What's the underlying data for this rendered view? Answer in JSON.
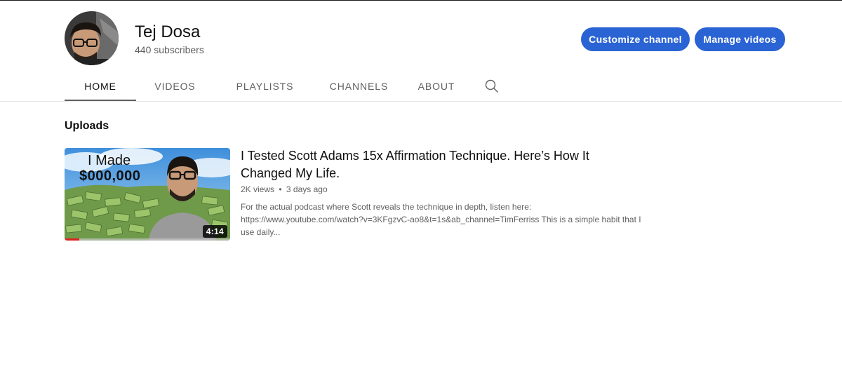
{
  "channel": {
    "name": "Tej Dosa",
    "subscribers": "440 subscribers"
  },
  "actions": {
    "customize_label": "Customize channel",
    "manage_label": "Manage videos"
  },
  "tabs": [
    {
      "label": "HOME",
      "active": true
    },
    {
      "label": "VIDEOS",
      "active": false
    },
    {
      "label": "PLAYLISTS",
      "active": false
    },
    {
      "label": "CHANNELS",
      "active": false
    },
    {
      "label": "ABOUT",
      "active": false
    }
  ],
  "search": {
    "icon": "search-icon"
  },
  "uploads": {
    "title": "Uploads",
    "videos": [
      {
        "title": "I Tested Scott Adams 15x Affirmation Technique. Here’s How It Changed My Life.",
        "views": "2K views",
        "separator": "•",
        "age": "3 days ago",
        "description": "For the actual podcast where Scott reveals the technique in depth, listen here: https://www.youtube.com/watch?v=3KFgzvC-ao8&t=1s&ab_channel=TimFerriss This is a simple habit that I use daily...",
        "duration": "4:14",
        "watched_fraction": 0.09,
        "thumbnail_text_line1": "I Made",
        "thumbnail_text_line2": "$000,000"
      }
    ]
  },
  "colors": {
    "accent_button": "#2a63d4",
    "progress": "#e02020",
    "muted_text": "#606060"
  }
}
